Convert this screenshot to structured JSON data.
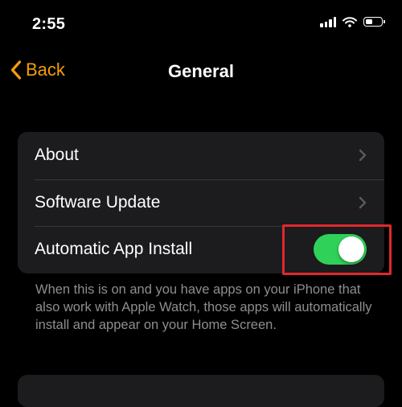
{
  "status_bar": {
    "time": "2:55",
    "icons": [
      "cellular-signal-icon",
      "wifi-icon",
      "battery-icon"
    ]
  },
  "nav": {
    "back_label": "Back",
    "title": "General"
  },
  "settings": {
    "rows": [
      {
        "label": "About",
        "accessory": "chevron-right-icon"
      },
      {
        "label": "Software Update",
        "accessory": "chevron-right-icon"
      },
      {
        "label": "Automatic App Install",
        "accessory": "toggle",
        "toggle_on": true
      }
    ],
    "footer": "When this is on and you have apps on your iPhone that also work with Apple Watch, those apps will automatically install and appear on your Home Screen."
  },
  "colors": {
    "accent": "#f59e0b",
    "toggle_on": "#30d158",
    "highlight": "#e0282e",
    "group_background": "#1c1c1e",
    "footer_text": "#8e8e93"
  }
}
